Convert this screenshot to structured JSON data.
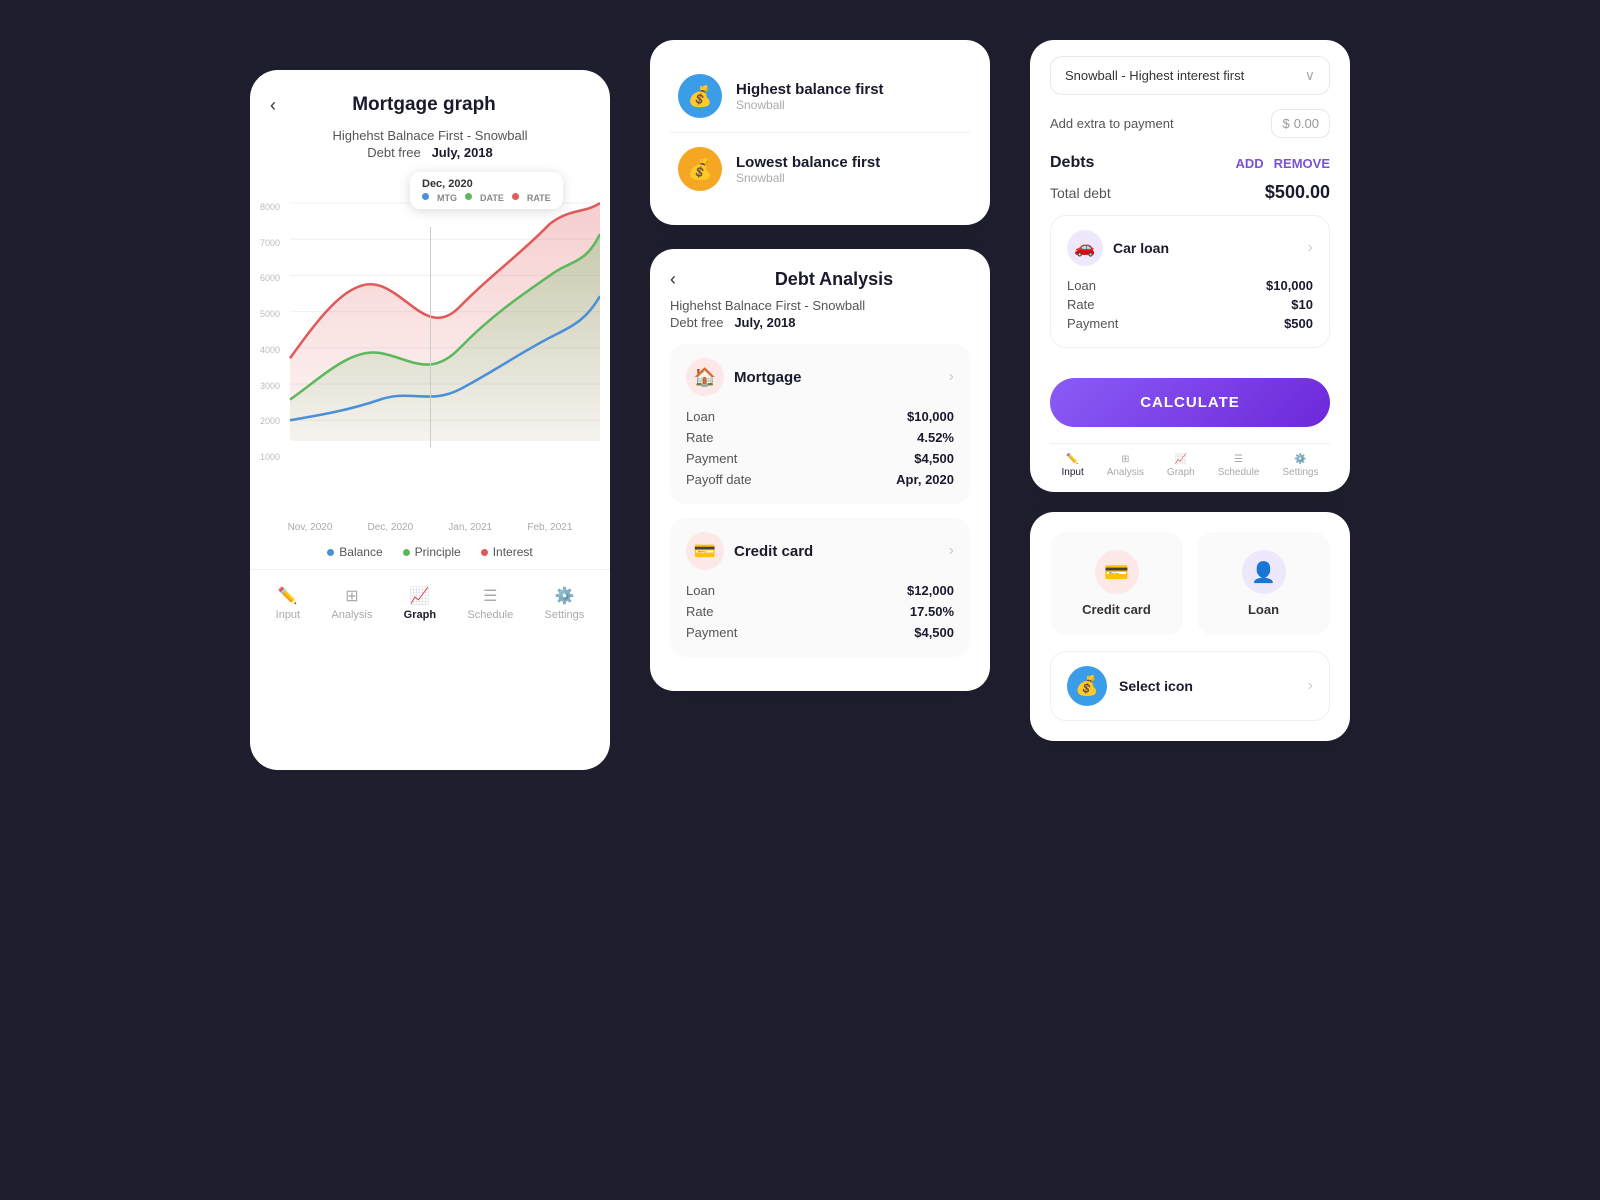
{
  "graph_panel": {
    "back_label": "‹",
    "title": "Mortgage graph",
    "subtitle": "Highehst Balnace First - Snowball",
    "debtfree_label": "Debt free",
    "debtfree_date": "July, 2018",
    "tooltip_date": "Dec, 2020",
    "y_labels": [
      "8000",
      "7000",
      "6000",
      "5000",
      "4000",
      "3000",
      "2000",
      "1000"
    ],
    "x_labels": [
      "Nov, 2020",
      "Dec, 2020",
      "Jan, 2021",
      "Feb, 2021"
    ],
    "legend": [
      {
        "color": "#4a90d9",
        "label": "Balance"
      },
      {
        "color": "#5cb85c",
        "label": "Principle"
      },
      {
        "color": "#e05a5a",
        "label": "Interest"
      }
    ],
    "nav_items": [
      {
        "icon": "✏️",
        "label": "Input",
        "active": false
      },
      {
        "icon": "📊",
        "label": "Analysis",
        "active": false
      },
      {
        "icon": "📈",
        "label": "Graph",
        "active": true
      },
      {
        "icon": "☰",
        "label": "Schedule",
        "active": false
      },
      {
        "icon": "⚙️",
        "label": "Settings",
        "active": false
      }
    ]
  },
  "strategy_panel": {
    "items": [
      {
        "icon": "💰",
        "icon_class": "icon-blue",
        "name": "Highest balance first",
        "sub": "Snowball"
      },
      {
        "icon": "💰",
        "icon_class": "icon-yellow",
        "name": "Lowest balance first",
        "sub": "Snowball"
      }
    ]
  },
  "debt_analysis": {
    "back": "‹",
    "title": "Debt Analysis",
    "subtitle": "Highehst Balnace First - Snowball",
    "debtfree_label": "Debt free",
    "debtfree_date": "July, 2018",
    "debts": [
      {
        "icon": "🏠",
        "icon_class": "icon-pink",
        "name": "Mortgage",
        "loan": "$10,000",
        "rate": "4.52%",
        "payment": "$4,500",
        "payoff_label": "Payoff date",
        "payoff_value": "Apr, 2020"
      },
      {
        "icon": "💳",
        "icon_class": "icon-coral",
        "name": "Credit card",
        "loan": "$12,000",
        "rate": "17.50%",
        "payment": "$4,500",
        "payoff_label": null,
        "payoff_value": null
      }
    ]
  },
  "input_panel": {
    "dropdown_label": "Snowball - Highest interest first",
    "extra_payment_label": "Add extra to payment",
    "extra_payment_currency": "$",
    "extra_payment_value": "0.00",
    "debts_title": "Debts",
    "add_label": "ADD",
    "remove_label": "REMOVE",
    "total_debt_label": "Total debt",
    "total_debt_amount": "$500.00",
    "debt": {
      "icon": "🚗",
      "icon_class": "icon-purple",
      "name": "Car loan",
      "loan_label": "Loan",
      "loan_value": "$10,000",
      "rate_label": "Rate",
      "rate_value": "$10",
      "payment_label": "Payment",
      "payment_value": "$500"
    },
    "calculate_label": "CALCULATE",
    "nav_items": [
      {
        "icon": "✏️",
        "label": "Input",
        "active": true
      },
      {
        "icon": "📊",
        "label": "Analysis",
        "active": false
      },
      {
        "icon": "📈",
        "label": "Graph",
        "active": false
      },
      {
        "icon": "☰",
        "label": "Schedule",
        "active": false
      },
      {
        "icon": "⚙️",
        "label": "Settings",
        "active": false
      }
    ]
  },
  "icon_selector": {
    "options": [
      {
        "icon": "💳",
        "icon_class": "icon-opt-pink",
        "label": "Credit card"
      },
      {
        "icon": "👤",
        "icon_class": "icon-opt-purple",
        "label": "Loan"
      }
    ],
    "select_icon_label": "Select icon",
    "select_icon_circle": "💰"
  }
}
